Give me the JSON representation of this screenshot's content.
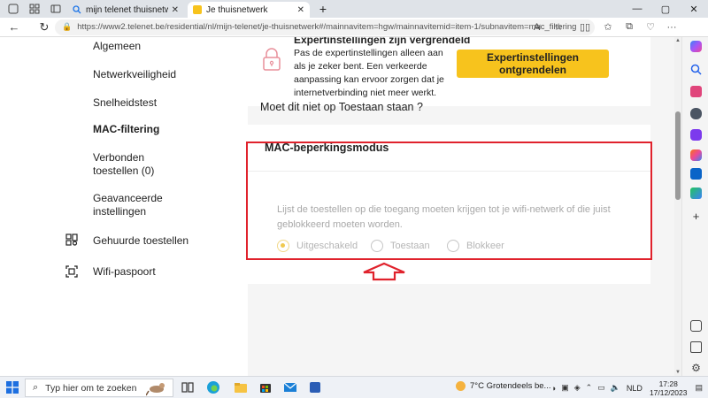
{
  "browser": {
    "tabs": [
      {
        "label": "mijn telenet thuisnetwerk - Zoek",
        "active": false
      },
      {
        "label": "Je thuisnetwerk",
        "active": true
      }
    ],
    "new_tab_label": "+",
    "url": "https://www2.telenet.be/residential/nl/mijn-telenet/je-thuisnetwerk#/mainnavitem=hgw/mainnavitemid=item-1/subnavitem=mac_filtering"
  },
  "sidebar": {
    "items": [
      {
        "label": "Algemeen",
        "active": false
      },
      {
        "label": "Netwerkveiligheid",
        "active": false
      },
      {
        "label": "Snelheidstest",
        "active": false
      },
      {
        "label": "MAC-filtering",
        "active": true
      },
      {
        "label": "Verbonden toestellen (0)",
        "active": false
      },
      {
        "label": "Geavanceerde instellingen",
        "active": false
      },
      {
        "label": "Gehuurde toestellen",
        "active": false,
        "icon": "rented-devices-icon"
      },
      {
        "label": "Wifi-paspoort",
        "active": false,
        "icon": "wifi-passport-icon"
      }
    ]
  },
  "expert": {
    "title": "Expertinstellingen zijn vergrendeld",
    "text": "Pas de expertinstellingen alleen aan als je zeker bent. Een verkeerde aanpassing kan ervoor zorgen dat je internetverbinding niet meer werkt.",
    "unlock_button": "Expertinstellingen ontgrendelen"
  },
  "question": "Moet dit niet op Toestaan staan ?",
  "mac": {
    "title": "MAC-beperkingsmodus",
    "description": "Lijst de toestellen op die toegang moeten krijgen tot je wifi-netwerk of die juist geblokkeerd moeten worden.",
    "options": [
      {
        "label": "Uitgeschakeld",
        "checked": true
      },
      {
        "label": "Toestaan",
        "checked": false
      },
      {
        "label": "Blokkeer",
        "checked": false
      }
    ]
  },
  "taskbar": {
    "search_placeholder": "Typ hier om te zoeken",
    "weather": "7°C  Grotendeels be...",
    "language": "NLD",
    "time": "17:28",
    "date": "17/12/2023"
  },
  "colors": {
    "accent_yellow": "#f7c31d",
    "highlight_red": "#e0222c"
  }
}
